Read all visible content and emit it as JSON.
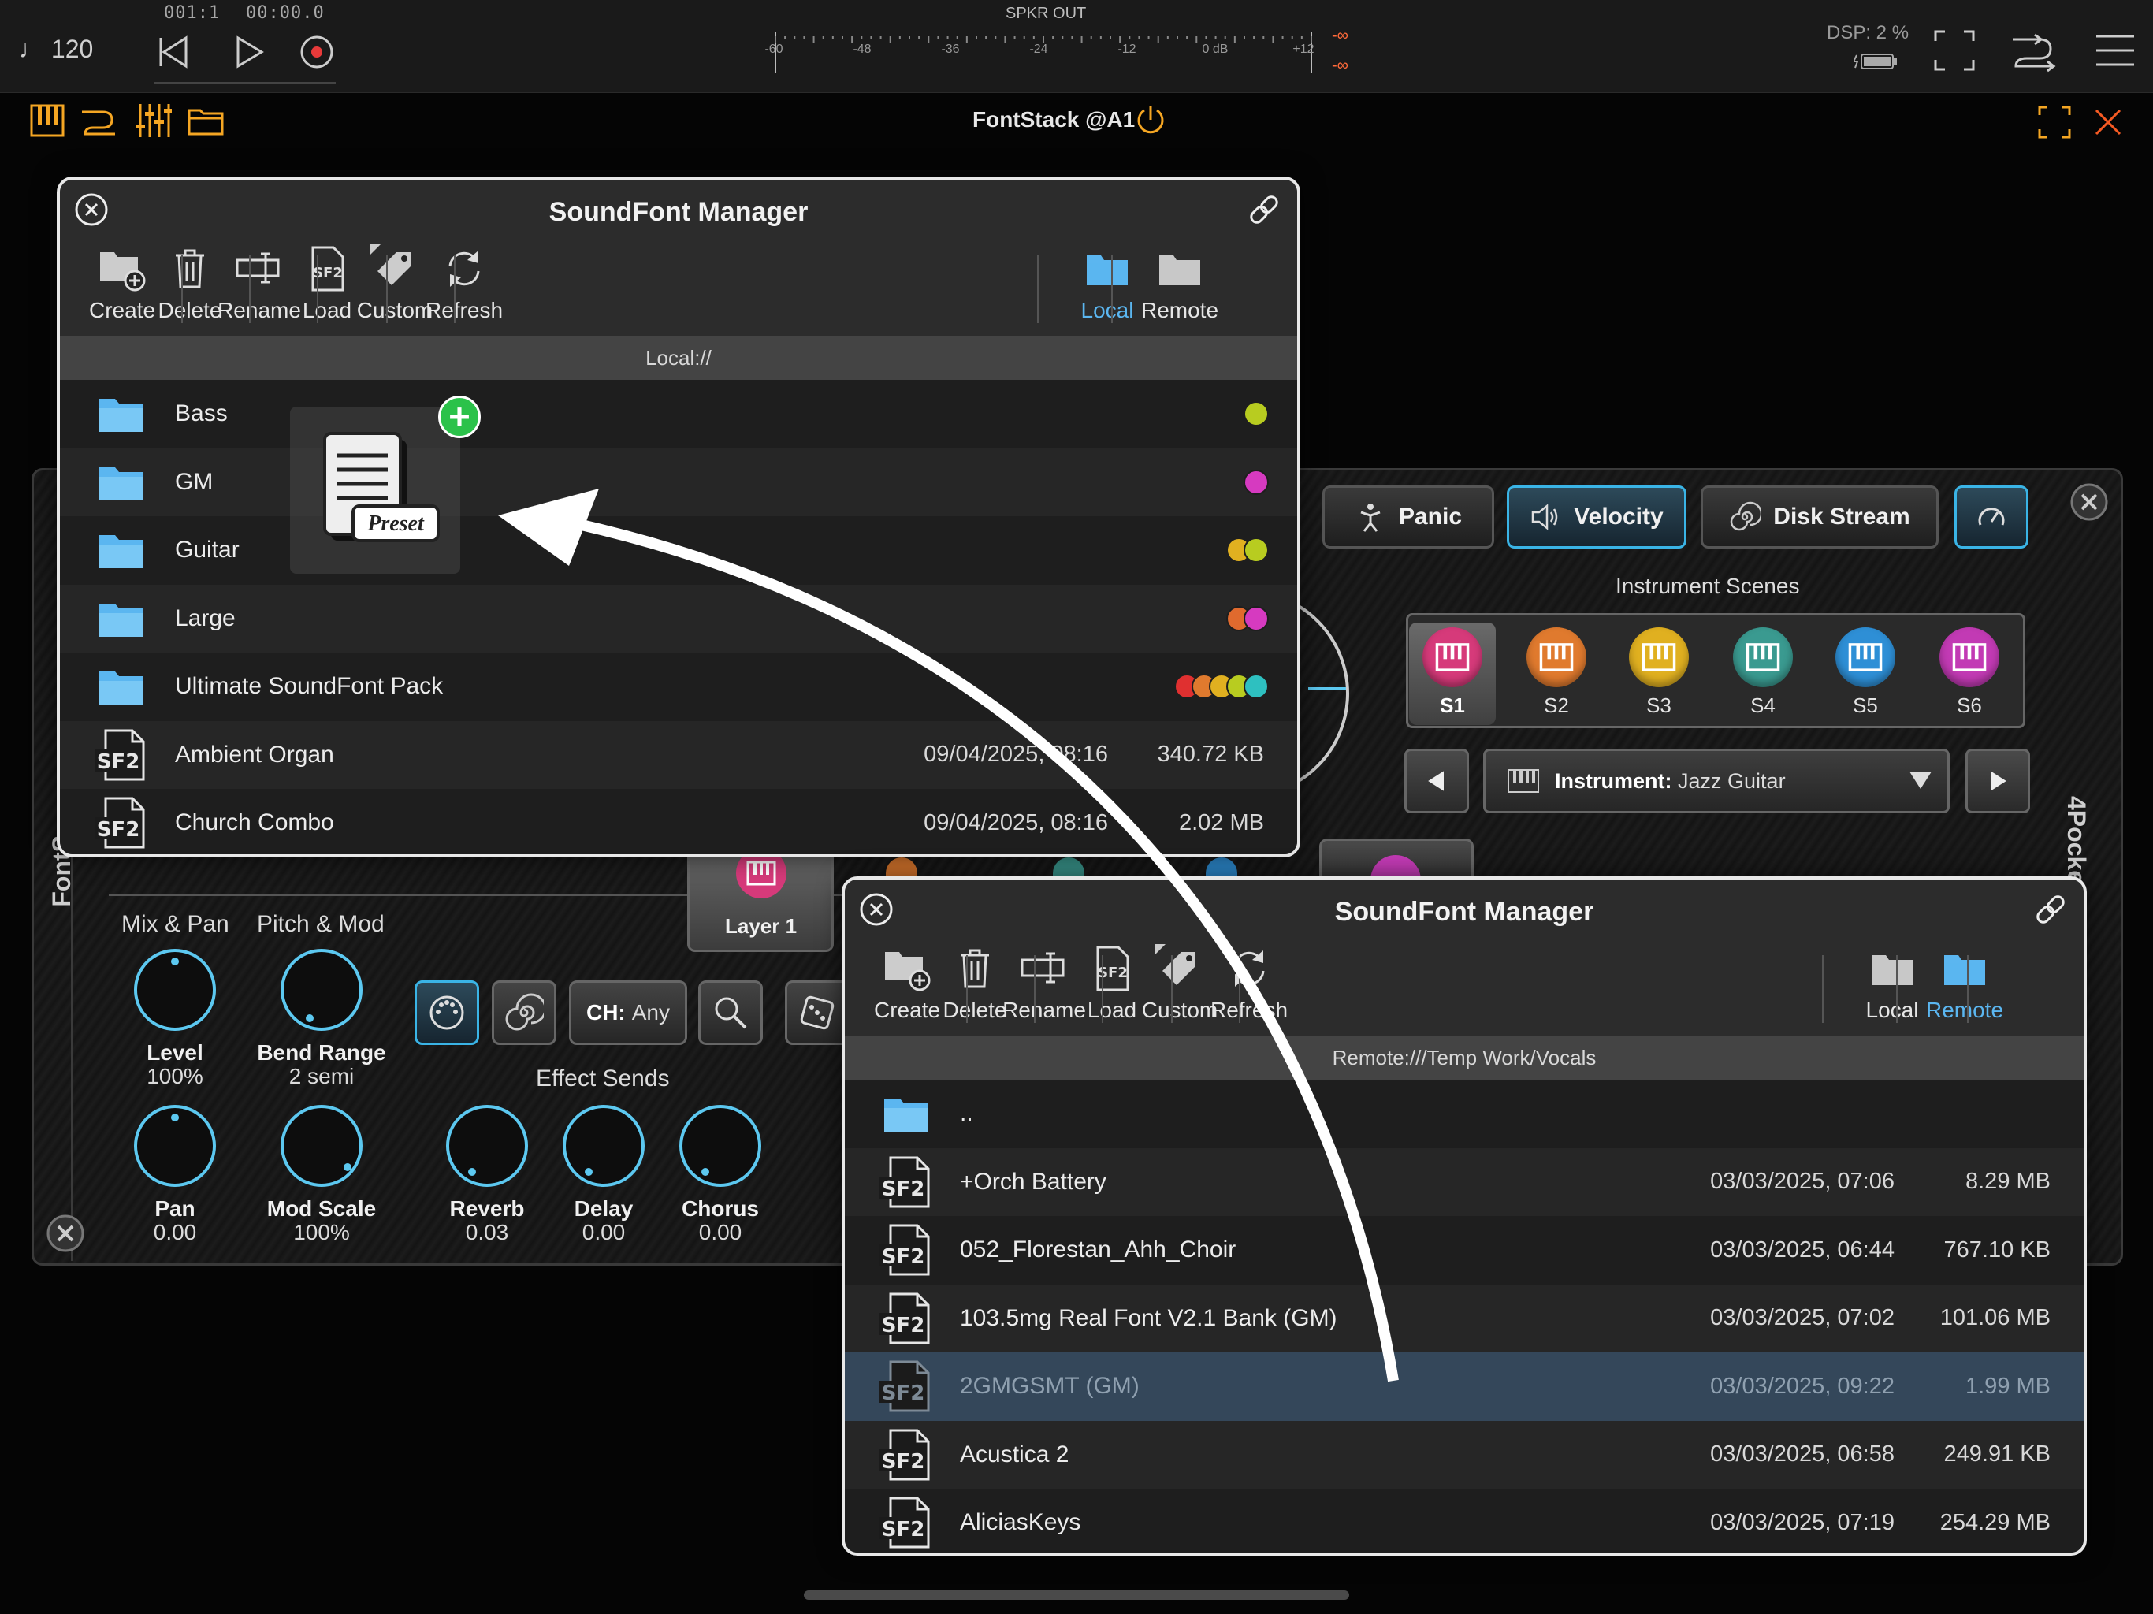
{
  "transport": {
    "tempo": "♩ 120",
    "bar_position": "001:1",
    "time_position": "00:00.0",
    "meter_label": "SPKR OUT",
    "meter_ticks": [
      "-60",
      "-48",
      "-36",
      "-24",
      "-12",
      "0 dB",
      "+12"
    ],
    "meter_peak_l": "-∞",
    "meter_peak_r": "-∞",
    "dsp": "DSP:  2 %"
  },
  "host": {
    "title": "FontStack @A1",
    "accent": "#f5a623"
  },
  "plugin": {
    "buttons": {
      "panic": "Panic",
      "velocity": "Velocity",
      "disk_stream": "Disk Stream"
    },
    "scenes_title": "Instrument Scenes",
    "scenes": [
      {
        "label": "S1",
        "color": "#d63a7a"
      },
      {
        "label": "S2",
        "color": "#e07a2e"
      },
      {
        "label": "S3",
        "color": "#e0b020"
      },
      {
        "label": "S4",
        "color": "#3a9a90"
      },
      {
        "label": "S5",
        "color": "#2e8fd6"
      },
      {
        "label": "S6",
        "color": "#c23ab4"
      }
    ],
    "instrument_prefix": "Instrument:",
    "instrument_name": "Jazz Guitar",
    "side_label_right": "4Pocket EY",
    "side_label_left": "FontS",
    "layer_label": "Layer 1",
    "ch_prefix": "CH:",
    "ch_value": "Any",
    "group_mix": "Mix & Pan",
    "group_pitch": "Pitch & Mod",
    "group_sends": "Effect Sends",
    "knobs": [
      {
        "name": "Level",
        "value": "100%"
      },
      {
        "name": "Bend Range",
        "value": "2 semi"
      },
      {
        "name": "Pan",
        "value": "0.00"
      },
      {
        "name": "Mod Scale",
        "value": "100%"
      },
      {
        "name": "Reverb",
        "value": "0.03"
      },
      {
        "name": "Delay",
        "value": "0.00"
      },
      {
        "name": "Chorus",
        "value": "0.00"
      }
    ]
  },
  "sfm1": {
    "title": "SoundFont Manager",
    "toolbar": [
      "Create",
      "Delete",
      "Rename",
      "Load",
      "Custom",
      "Refresh",
      "Local",
      "Remote"
    ],
    "path": "Local://",
    "rows": [
      {
        "type": "folder",
        "name": "Bass",
        "tags": [
          "#b8cc20"
        ]
      },
      {
        "type": "folder",
        "name": "GM",
        "tags": [
          "#d63ac0"
        ]
      },
      {
        "type": "folder",
        "name": "Guitar",
        "tags": [
          "#e0b020",
          "#b8cc20"
        ]
      },
      {
        "type": "folder",
        "name": "Large",
        "tags": [
          "#e06a2e",
          "#d63ac0"
        ]
      },
      {
        "type": "folder",
        "name": "Ultimate SoundFont Pack",
        "tags": [
          "#e03030",
          "#e07a2e",
          "#e0b020",
          "#b8cc20",
          "#2ec0c0"
        ]
      },
      {
        "type": "sf2",
        "name": "Ambient Organ",
        "date": "09/04/2025, 08:16",
        "size": "340.72 KB"
      },
      {
        "type": "sf2",
        "name": "Church Combo",
        "date": "09/04/2025, 08:16",
        "size": "2.02 MB"
      }
    ],
    "drag_label": "Preset"
  },
  "sfm2": {
    "title": "SoundFont Manager",
    "toolbar": [
      "Create",
      "Delete",
      "Rename",
      "Load",
      "Custom",
      "Refresh",
      "Local",
      "Remote"
    ],
    "path": "Remote:///Temp Work/Vocals",
    "rows": [
      {
        "type": "folder",
        "name": ".."
      },
      {
        "type": "sf2",
        "name": "+Orch Battery",
        "date": "03/03/2025, 07:06",
        "size": "8.29 MB"
      },
      {
        "type": "sf2",
        "name": "052_Florestan_Ahh_Choir",
        "date": "03/03/2025, 06:44",
        "size": "767.10 KB"
      },
      {
        "type": "sf2",
        "name": "103.5mg Real Font V2.1 Bank (GM)",
        "date": "03/03/2025, 07:02",
        "size": "101.06 MB"
      },
      {
        "type": "sf2",
        "name": "2GMGSMT (GM)",
        "date": "03/03/2025, 09:22",
        "size": "1.99 MB",
        "selected": true
      },
      {
        "type": "sf2",
        "name": "Acustica 2",
        "date": "03/03/2025, 06:58",
        "size": "249.91 KB"
      },
      {
        "type": "sf2",
        "name": "AliciasKeys",
        "date": "03/03/2025, 07:19",
        "size": "254.29 MB"
      }
    ]
  }
}
